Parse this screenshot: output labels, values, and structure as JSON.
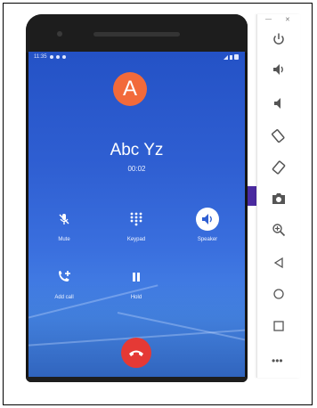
{
  "call": {
    "avatar_letter": "A",
    "caller_name": "Abc Yz",
    "timer": "00:02"
  },
  "controls": {
    "mute": "Mute",
    "keypad": "Keypad",
    "speaker": "Speaker",
    "add_call": "Add call",
    "hold": "Hold"
  },
  "status": {
    "time": "11:35"
  },
  "sidebar": {
    "more": "•••",
    "icons": [
      "power-icon",
      "volume-up-icon",
      "volume-down-icon",
      "rotate-left-icon",
      "rotate-right-icon",
      "camera-icon",
      "zoom-icon",
      "back-icon",
      "home-icon",
      "overview-icon",
      "more-icon"
    ]
  },
  "colors": {
    "accent": "#2f5fd2",
    "avatar": "#f26a3a",
    "end_call": "#e53935"
  }
}
